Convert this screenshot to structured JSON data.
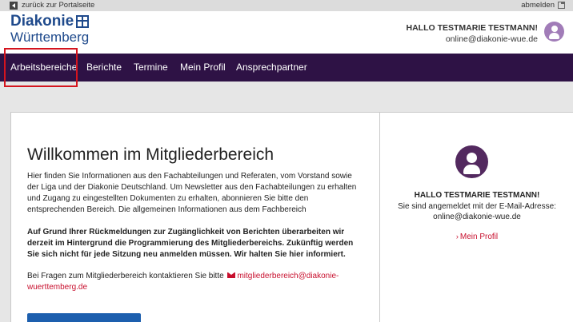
{
  "topbar": {
    "back_label": "zurück zur Portalseite",
    "logout_label": "abmelden"
  },
  "logo": {
    "line1": "Diakonie",
    "line2": "Württemberg"
  },
  "user": {
    "name": "HALLO TESTMARIE TESTMANN!",
    "email": "online@diakonie-wue.de"
  },
  "nav": {
    "items": [
      "Arbeitsbereiche",
      "Berichte",
      "Termine",
      "Mein Profil",
      "Ansprechpartner"
    ],
    "active": "Arbeitsbereiche",
    "highlight_color": "#d4141e",
    "background": "#2e1245"
  },
  "main": {
    "title": "Willkommen im Mitgliederbereich",
    "p1": "Hier finden Sie Informationen aus den Fachabteilungen und Referaten, vom Vorstand sowie der Liga und der Diakonie Deutschland. Um Newsletter aus den Fachabteilungen zu erhalten und Zugang zu eingestellten Dokumenten zu erhalten, abonnieren Sie bitte den entsprechenden Bereich. Die allgemeinen Informationen aus dem Fachbereich",
    "p2": "Auf Grund Ihrer Rückmeldungen zur Zugänglichkeit von Berichten überarbeiten wir derzeit im Hintergrund die Programmierung des Mitgliederbereichs. Zukünftig werden Sie sich nicht für jede Sitzung neu anmelden müssen. Wir halten Sie hier informiert.",
    "p3_prefix": "Bei Fragen zum Mitgliederbereich kontaktieren Sie bitte",
    "p3_email": "mitgliederbereich@diakonie-wuerttemberg.de",
    "button_color": "#1d5fae"
  },
  "side": {
    "name": "HALLO TESTMARIE TESTMANN!",
    "line2": "Sie sind angemeldet mit der E-Mail-Adresse:",
    "email": "online@diakonie-wue.de",
    "profile_link": "Mein Profil"
  }
}
